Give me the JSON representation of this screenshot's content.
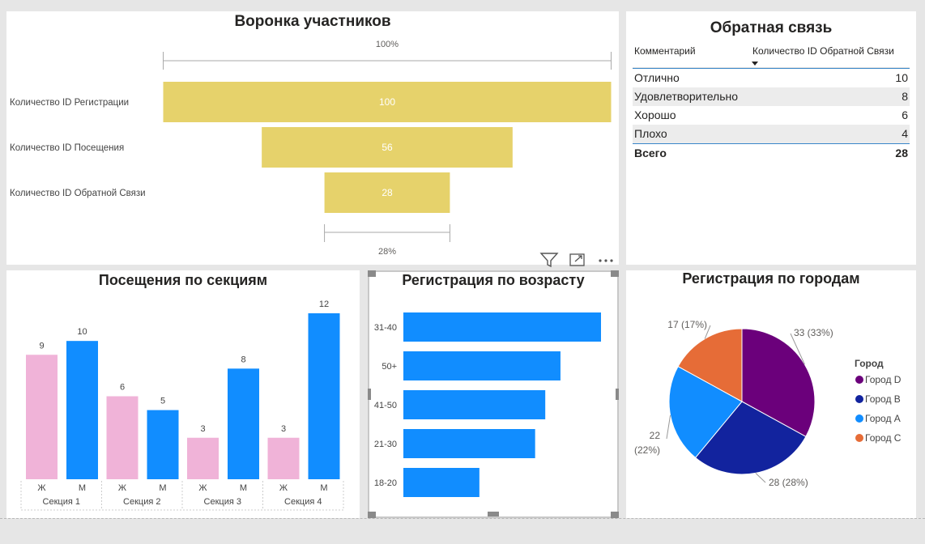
{
  "funnel": {
    "title": "Воронка участников",
    "top_pct": "100%",
    "bottom_pct": "28%",
    "colors": {
      "bar": "#e6d26b"
    }
  },
  "feedback": {
    "title": "Обратная связь",
    "col1": "Комментарий",
    "col2": "Количество ID Обратной Связи",
    "rows": [
      {
        "label": "Отлично",
        "value": "10"
      },
      {
        "label": "Удовлетворительно",
        "value": "8"
      },
      {
        "label": "Хорошо",
        "value": "6"
      },
      {
        "label": "Плохо",
        "value": "4"
      }
    ],
    "total_label": "Всего",
    "total_value": "28"
  },
  "visits": {
    "title": "Посещения по секциям"
  },
  "age": {
    "title": "Регистрация по возрасту"
  },
  "cities": {
    "title": "Регистрация по городам",
    "legend_title": "Город"
  },
  "icons": [
    "filter-icon",
    "focus-mode-icon",
    "more-options-icon"
  ],
  "chart_data": [
    {
      "type": "bar",
      "orientation": "funnel",
      "categories": [
        "Количество ID Регистрации",
        "Количество ID Посещения",
        "Количество ID Обратной Связи"
      ],
      "values": [
        100,
        56,
        28
      ],
      "data_labels": [
        "100",
        "56",
        "28"
      ],
      "color": "#e6d26b"
    },
    {
      "type": "bar",
      "categories": [
        "Ж",
        "М",
        "Ж",
        "М",
        "Ж",
        "М",
        "Ж",
        "М"
      ],
      "groups": [
        "Секция 1",
        "Секция 2",
        "Секция 3",
        "Секция 4"
      ],
      "values": [
        9,
        10,
        6,
        5,
        3,
        8,
        3,
        12
      ],
      "colors": {
        "Ж": "#f0b3d8",
        "М": "#118dff"
      },
      "ylim": [
        0,
        12
      ]
    },
    {
      "type": "bar",
      "orientation": "horizontal",
      "categories": [
        "31-40",
        "50+",
        "41-50",
        "21-30",
        "18-20"
      ],
      "values": [
        39,
        31,
        28,
        26,
        15
      ],
      "color": "#118dff"
    },
    {
      "type": "pie",
      "slices": [
        {
          "name": "Город D",
          "value": 33,
          "label": "33 (33%)",
          "color": "#6b007b"
        },
        {
          "name": "Город B",
          "value": 28,
          "label": "28 (28%)",
          "color": "#12239e"
        },
        {
          "name": "Город A",
          "value": 22,
          "label_value": "22",
          "label_pct": "(22%)",
          "color": "#118dff"
        },
        {
          "name": "Город C",
          "value": 17,
          "label": "17 (17%)",
          "color": "#e66c37"
        }
      ],
      "legend_placement": "right"
    }
  ]
}
